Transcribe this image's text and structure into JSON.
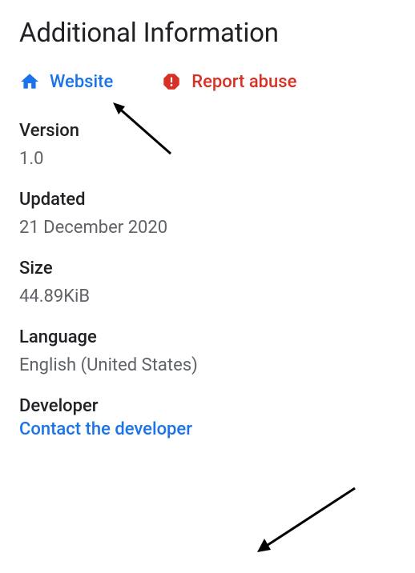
{
  "title": "Additional Information",
  "links": {
    "website_label": "Website",
    "report_label": "Report abuse"
  },
  "version": {
    "label": "Version",
    "value": "1.0"
  },
  "updated": {
    "label": "Updated",
    "value": "21 December 2020"
  },
  "size": {
    "label": "Size",
    "value": "44.89KiB"
  },
  "language": {
    "label": "Language",
    "value": "English (United States)"
  },
  "developer": {
    "label": "Developer",
    "contact_label": "Contact the developer"
  }
}
